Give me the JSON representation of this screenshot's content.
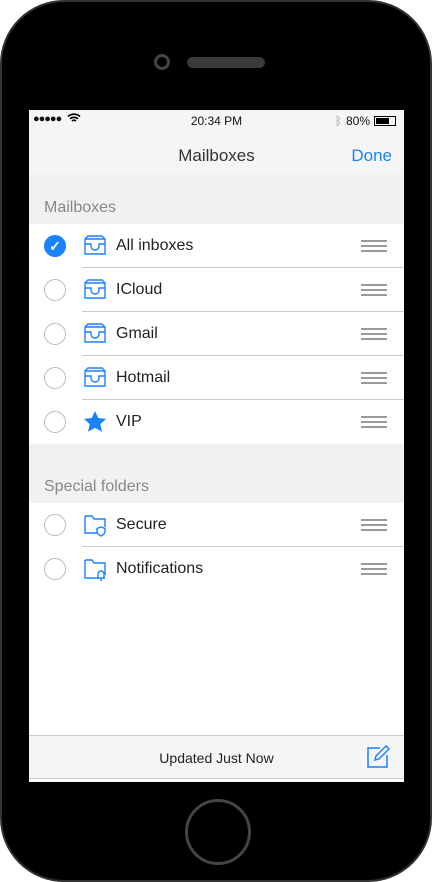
{
  "status": {
    "signal": "●●●●●",
    "time": "20:34 PM",
    "battery": "80%"
  },
  "nav": {
    "title": "Mailboxes",
    "done": "Done"
  },
  "sections": [
    {
      "header": "Mailboxes",
      "items": [
        {
          "label": "All inboxes",
          "icon": "inbox-icon",
          "checked": true
        },
        {
          "label": "ICloud",
          "icon": "inbox-icon",
          "checked": false
        },
        {
          "label": "Gmail",
          "icon": "inbox-icon",
          "checked": false
        },
        {
          "label": "Hotmail",
          "icon": "inbox-icon",
          "checked": false
        },
        {
          "label": "VIP",
          "icon": "star-icon",
          "checked": false
        }
      ]
    },
    {
      "header": "Special folders",
      "items": [
        {
          "label": "Secure",
          "icon": "folder-shield-icon",
          "checked": false
        },
        {
          "label": "Notifications",
          "icon": "folder-bell-icon",
          "checked": false
        }
      ]
    }
  ],
  "toolbar": {
    "status": "Updated Just Now"
  },
  "colors": {
    "accent": "#1a82fb"
  }
}
